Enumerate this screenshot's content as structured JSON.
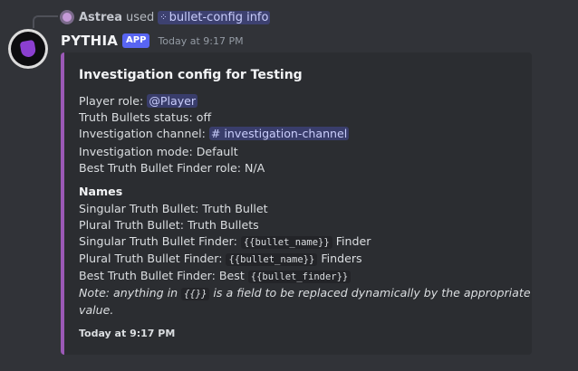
{
  "reply": {
    "user": "Astrea",
    "action": "used",
    "command": "bullet-config info"
  },
  "message": {
    "username": "PYTHIA",
    "badge": "APP",
    "timestamp": "Today at 9:17 PM"
  },
  "embed": {
    "accent_color": "#9b59b6",
    "title": "Investigation config for Testing",
    "player_role_label": "Player role:",
    "player_role_value": "@Player",
    "truth_bullets_status": "Truth Bullets status: off",
    "investigation_channel_label": "Investigation channel:",
    "investigation_channel_value": "# investigation-channel",
    "investigation_mode": "Investigation mode: Default",
    "best_finder_role": "Best Truth Bullet Finder role: N/A",
    "names_heading": "Names",
    "singular_bullet": "Singular Truth Bullet: Truth Bullet",
    "plural_bullet": "Plural Truth Bullet: Truth Bullets",
    "singular_finder_label": "Singular Truth Bullet Finder:",
    "singular_finder_code": "{{bullet_name}}",
    "singular_finder_suffix": "Finder",
    "plural_finder_label": "Plural Truth Bullet Finder:",
    "plural_finder_code": "{{bullet_name}}",
    "plural_finder_suffix": "Finders",
    "best_finder_label": "Best Truth Bullet Finder: Best",
    "best_finder_code": "{{bullet_finder}}",
    "note_prefix": "Note: anything in",
    "note_code": "{{}}",
    "note_suffix": "is a field to be replaced dynamically by the appropriate",
    "note_line2": "value.",
    "footer_timestamp": "Today at 9:17 PM"
  }
}
